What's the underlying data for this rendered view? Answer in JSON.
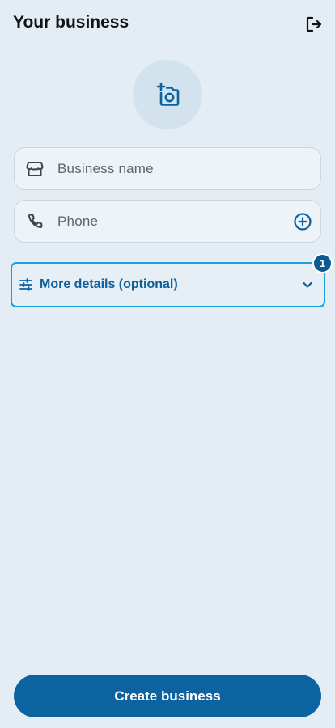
{
  "header": {
    "title": "Your business",
    "logout_icon": "logout-icon"
  },
  "photo": {
    "icon": "add-photo-icon"
  },
  "form": {
    "business_name": {
      "placeholder": "Business name",
      "value": "",
      "icon": "storefront-icon"
    },
    "phone": {
      "placeholder": "Phone",
      "value": "",
      "icon": "phone-icon",
      "add_icon": "add-circle-icon"
    },
    "more_details": {
      "label": "More details (optional)",
      "icon": "tune-icon",
      "chevron": "chevron-down-icon",
      "badge": "1"
    }
  },
  "footer": {
    "create_label": "Create business"
  },
  "colors": {
    "background": "#e4edf4",
    "primary": "#0d639f",
    "accent_border": "#1aa0d9",
    "label_blue": "#0e5f9a"
  }
}
